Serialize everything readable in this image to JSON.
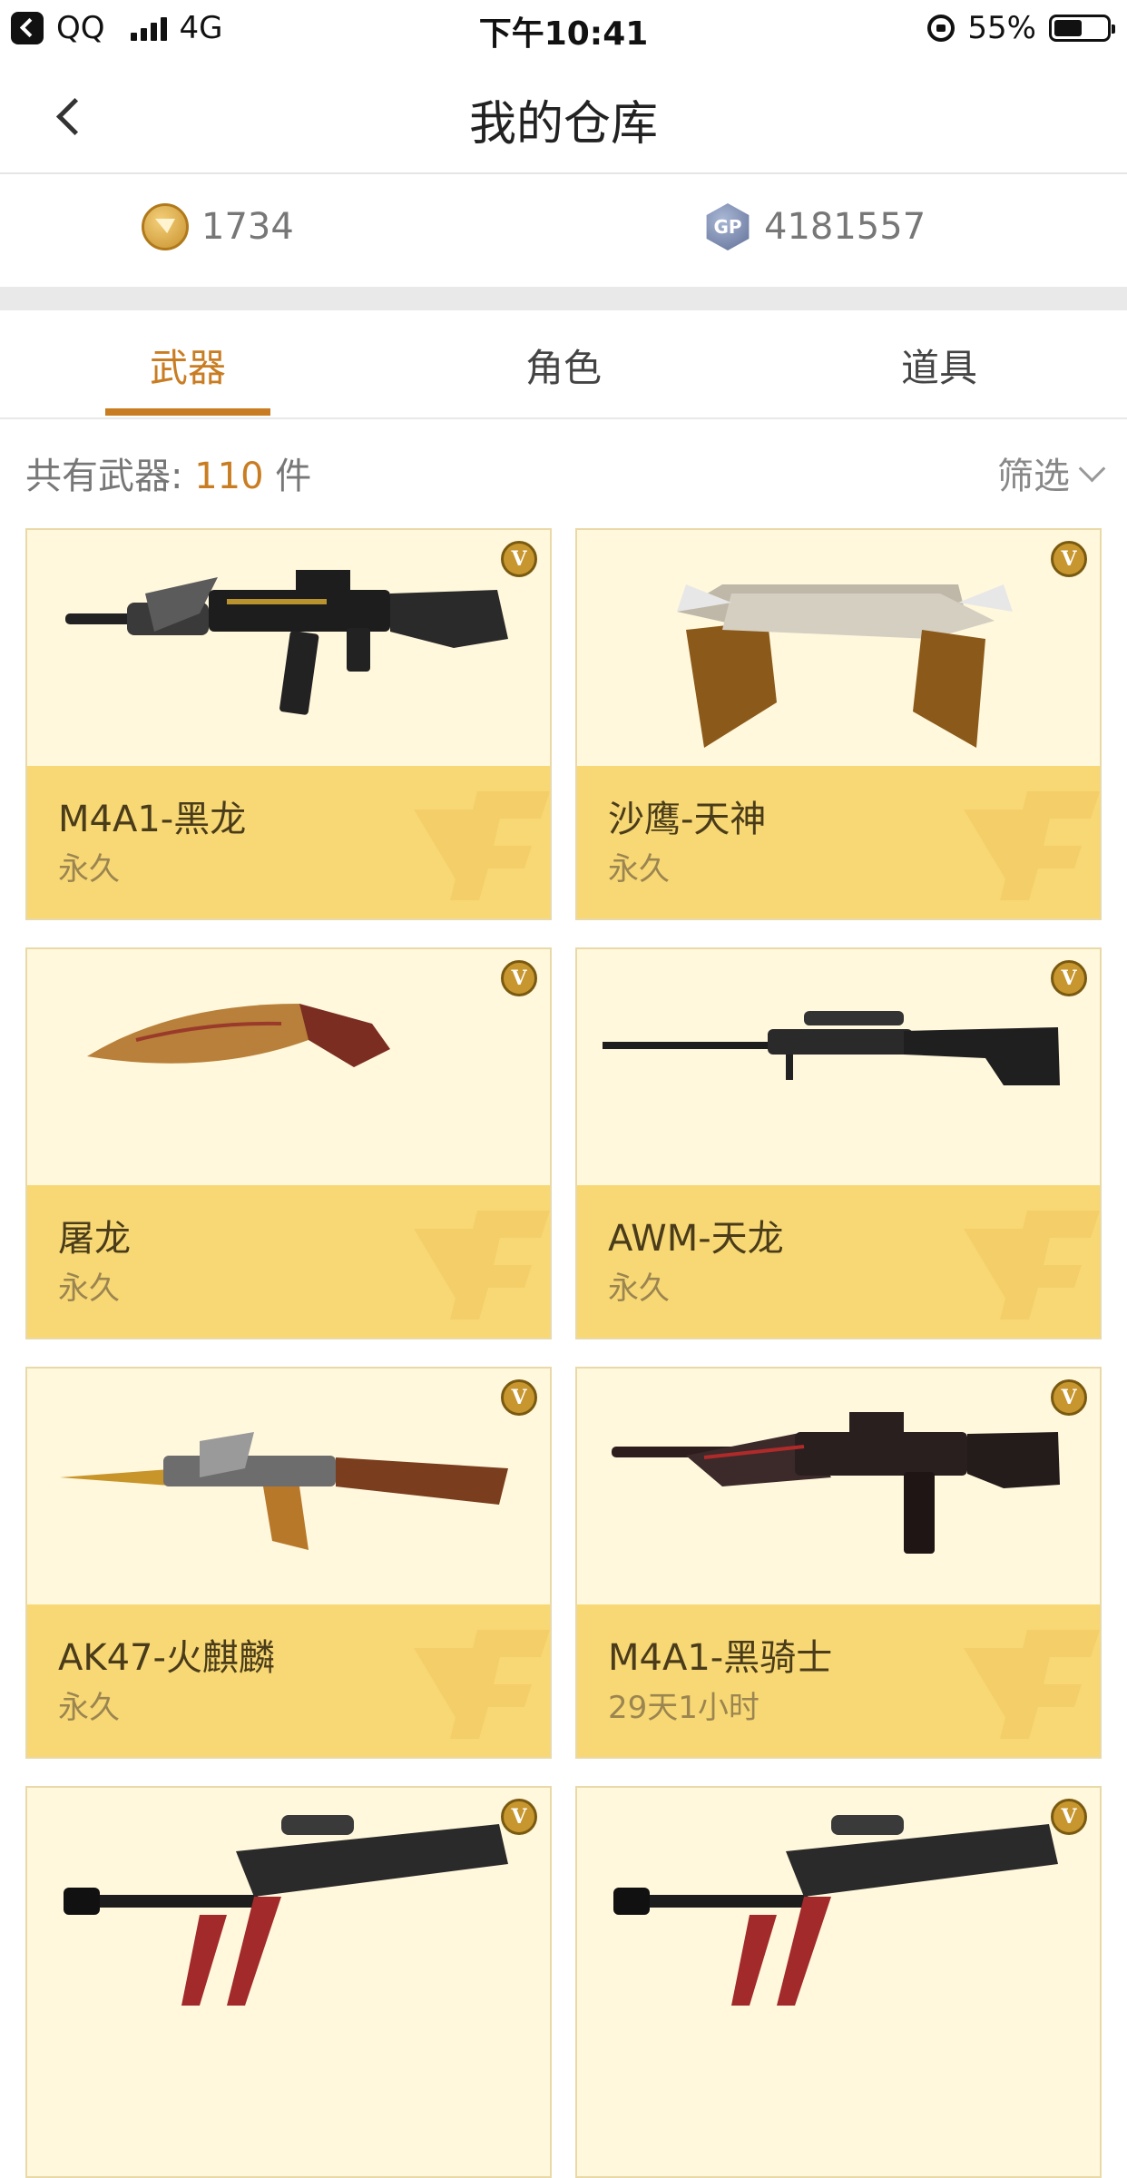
{
  "status_bar": {
    "carrier": "QQ",
    "network": "4G",
    "time": "下午10:41",
    "battery": "55%"
  },
  "nav": {
    "title": "我的仓库"
  },
  "currency": {
    "cf_points": "1734",
    "gp_label": "GP",
    "gp_points": "4181557"
  },
  "tabs": [
    {
      "label": "武器",
      "active": true
    },
    {
      "label": "角色",
      "active": false
    },
    {
      "label": "道具",
      "active": false
    }
  ],
  "summary": {
    "prefix": "共有武器:",
    "count": "110",
    "suffix": "件",
    "filter_label": "筛选"
  },
  "vip_badge": "V",
  "items": [
    {
      "name": "M4A1-黑龙",
      "duration": "永久",
      "icon": "rifle-black-dragon-icon"
    },
    {
      "name": "沙鹰-天神",
      "duration": "永久",
      "icon": "dual-pistols-icon"
    },
    {
      "name": "屠龙",
      "duration": "永久",
      "icon": "kukri-knife-icon"
    },
    {
      "name": "AWM-天龙",
      "duration": "永久",
      "icon": "sniper-rifle-icon"
    },
    {
      "name": "AK47-火麒麟",
      "duration": "永久",
      "icon": "ak47-icon"
    },
    {
      "name": "M4A1-黑骑士",
      "duration": "29天1小时",
      "icon": "rifle-black-knight-icon"
    },
    {
      "name": "",
      "duration": "",
      "icon": "heavy-sniper-icon"
    },
    {
      "name": "",
      "duration": "",
      "icon": "heavy-sniper-icon"
    }
  ],
  "colors": {
    "accent": "#c97d23",
    "card_bg": "#fff8dd",
    "card_info_bg": "#f8d874"
  }
}
